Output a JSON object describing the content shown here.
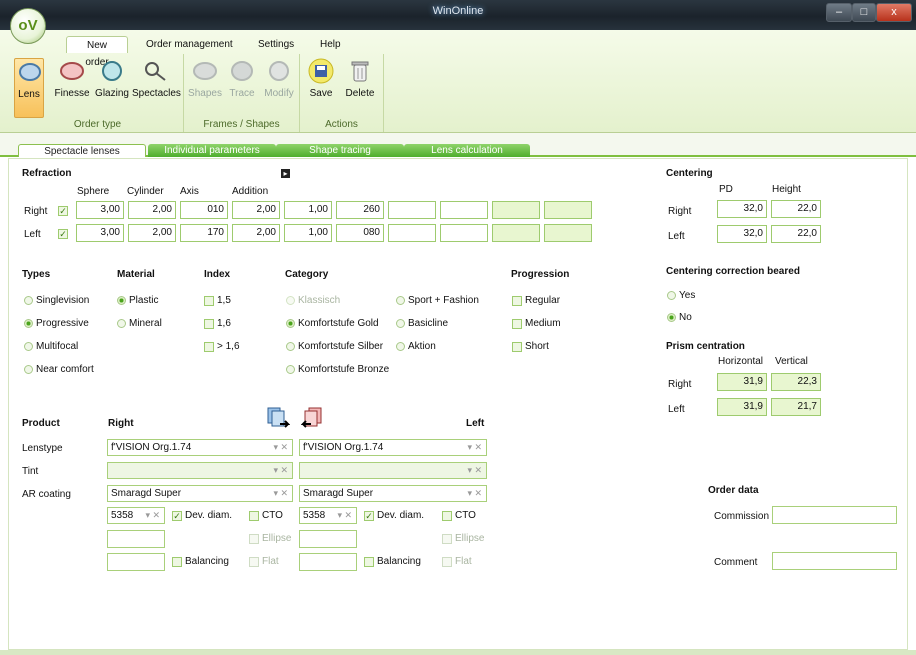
{
  "window": {
    "title": "WinOnline",
    "min": "–",
    "max": "□",
    "close": "x",
    "logo": "oV"
  },
  "menu": [
    "New order",
    "Order management",
    "Settings",
    "Help"
  ],
  "ribbon": {
    "groups": [
      {
        "title": "Order type"
      },
      {
        "title": "Frames / Shapes"
      },
      {
        "title": "Actions"
      }
    ],
    "order_type": [
      "Lens",
      "Finesse",
      "Glazing",
      "Spectacles"
    ],
    "frames": [
      "Shapes",
      "Trace",
      "Modify"
    ],
    "actions": [
      "Save",
      "Delete"
    ]
  },
  "tabs": [
    "Spectacle lenses",
    "Individual parameters",
    "Shape tracing",
    "Lens calculation"
  ],
  "refraction": {
    "title": "Refraction",
    "headers": [
      "Sphere",
      "Cylinder",
      "Axis",
      "Addition"
    ],
    "right": {
      "label": "Right",
      "sphere": "3,00",
      "cylinder": "2,00",
      "axis": "010",
      "addition": "2,00",
      "c5": "1,00",
      "c6": "260"
    },
    "left": {
      "label": "Left",
      "sphere": "3,00",
      "cylinder": "2,00",
      "axis": "170",
      "addition": "2,00",
      "c5": "1,00",
      "c6": "080"
    }
  },
  "centering": {
    "title": "Centering",
    "pd": "PD",
    "height": "Height",
    "right": {
      "label": "Right",
      "pd": "32,0",
      "height": "22,0"
    },
    "left": {
      "label": "Left",
      "pd": "32,0",
      "height": "22,0"
    }
  },
  "types": {
    "title": "Types",
    "items": [
      "Singlevision",
      "Progressive",
      "Multifocal",
      "Near comfort"
    ]
  },
  "material": {
    "title": "Material",
    "items": [
      "Plastic",
      "Mineral"
    ]
  },
  "index": {
    "title": "Index",
    "items": [
      "1,5",
      "1,6",
      "> 1,6"
    ]
  },
  "category": {
    "title": "Category",
    "col1": [
      "Klassisch",
      "Komfortstufe Gold",
      "Komfortstufe Silber",
      "Komfortstufe Bronze"
    ],
    "col2": [
      "Sport + Fashion",
      "Basicline",
      "Aktion"
    ]
  },
  "progression": {
    "title": "Progression",
    "items": [
      "Regular",
      "Medium",
      "Short"
    ]
  },
  "ccb": {
    "title": "Centering correction beared",
    "yes": "Yes",
    "no": "No"
  },
  "prism": {
    "title": "Prism centration",
    "horizontal": "Horizontal",
    "vertical": "Vertical",
    "right": {
      "label": "Right",
      "h": "31,9",
      "v": "22,3"
    },
    "left": {
      "label": "Left",
      "h": "31,9",
      "v": "21,7"
    }
  },
  "product": {
    "title": "Product",
    "right": "Right",
    "left": "Left",
    "rows": [
      "Lenstype",
      "Tint",
      "AR coating"
    ],
    "lenstype_right": "f'VISION Org.1.74",
    "lenstype_left": "f'VISION Org.1.74",
    "ar_right": "Smaragd Super",
    "ar_left": "Smaragd Super",
    "code_right": "5358",
    "code_left": "5358",
    "dev_diam": "Dev. diam.",
    "cto": "CTO",
    "ellipse": "Ellipse",
    "balancing": "Balancing",
    "flat": "Flat"
  },
  "order": {
    "title": "Order data",
    "commission": "Commission",
    "comment": "Comment"
  }
}
